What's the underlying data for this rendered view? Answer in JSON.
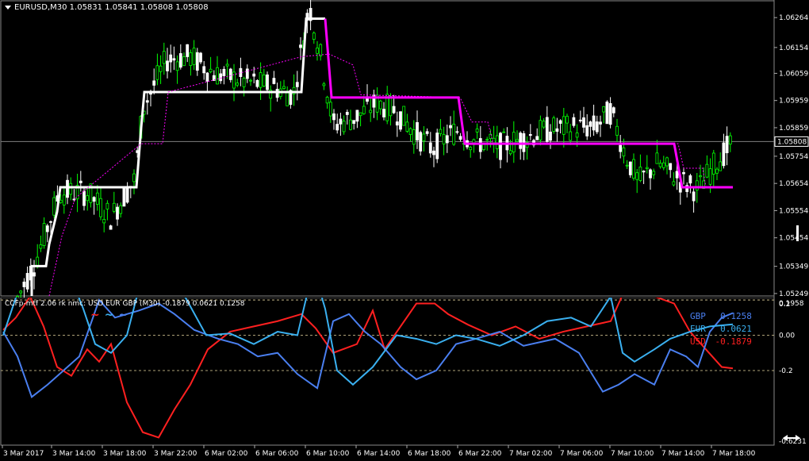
{
  "chart": {
    "symbol_line": "EURUSD,M30  1.05831 1.05841 1.05808 1.05808",
    "price_levels": [
      "1.06264",
      "1.06154",
      "1.06059",
      "1.05959",
      "1.05859",
      "1.05754",
      "1.05654",
      "1.05554",
      "1.05454",
      "1.05349",
      "1.05249"
    ],
    "current_price": "1.05808",
    "price_min": 1.0524,
    "price_max": 1.0632,
    "colors": {
      "bull": "#00ff00",
      "bear": "#ffffff",
      "step_white": "#ffffff",
      "step_magenta": "#ff00ff",
      "grid": "#3a3a3a",
      "current_line": "#808080"
    }
  },
  "indicator": {
    "header": "CCFp-mtf 2.06 rk nmc:  USD EUR GBP (M30) -0.1879 0.0621 0.1258",
    "scale_labels": [
      "0.1958",
      "0.2",
      "0.00",
      "-0.2",
      "-0.6231"
    ],
    "legend": [
      {
        "name": "GBP",
        "value": "0.1258",
        "color": "#4a7ff0"
      },
      {
        "name": "EUR",
        "value": "0.0621",
        "color": "#3ab0f0"
      },
      {
        "name": "USD",
        "value": "-0.1879",
        "color": "#ff2020"
      }
    ]
  },
  "time_axis": [
    "3 Mar 2017",
    "3 Mar 14:00",
    "3 Mar 18:00",
    "3 Mar 22:00",
    "6 Mar 02:00",
    "6 Mar 06:00",
    "6 Mar 10:00",
    "6 Mar 14:00",
    "6 Mar 18:00",
    "6 Mar 22:00",
    "7 Mar 02:00",
    "7 Mar 06:00",
    "7 Mar 10:00",
    "7 Mar 14:00",
    "7 Mar 18:00"
  ]
}
